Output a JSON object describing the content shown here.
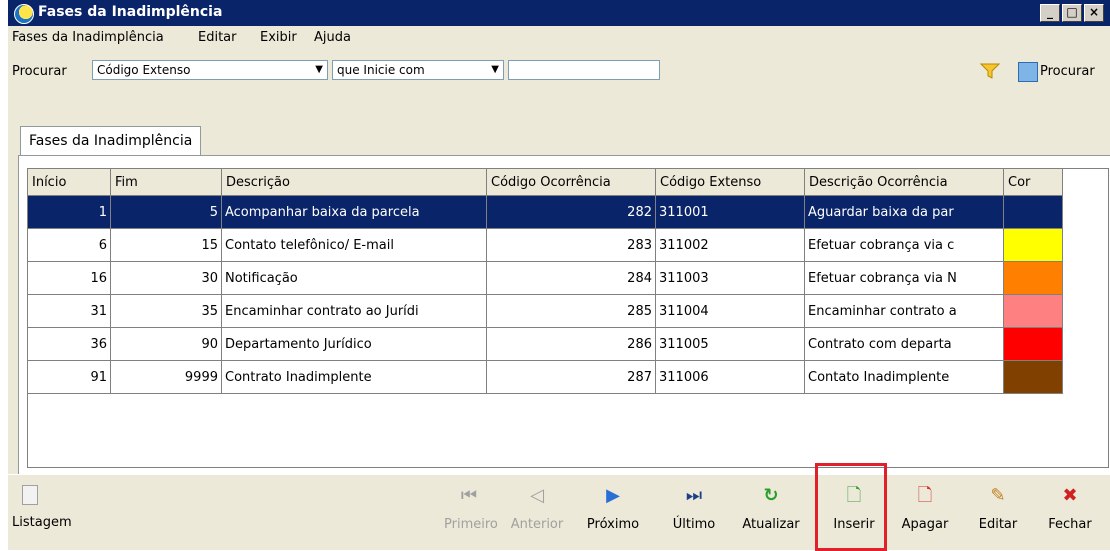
{
  "window": {
    "title": "Fases da Inadimplência"
  },
  "menu": [
    {
      "label": "Fases da Inadimplência"
    },
    {
      "label": "Editar"
    },
    {
      "label": "Exibir"
    },
    {
      "label": "Ajuda"
    }
  ],
  "search": {
    "label": "Procurar",
    "field": "Código Extenso",
    "mode": "que Inicie com",
    "value": "",
    "button_label": "Procurar"
  },
  "tab": {
    "label": "Fases da Inadimplência"
  },
  "grid": {
    "columns": [
      "Início",
      "Fim",
      "Descrição",
      "Código Ocorrência",
      "Código Extenso",
      "Descrição Ocorrência",
      "Cor"
    ],
    "rows": [
      {
        "inicio": "1",
        "fim": "5",
        "descricao": "Acompanhar baixa da parcela",
        "cod_ocorrencia": "282",
        "cod_extenso": "311001",
        "desc_ocorrencia": "Aguardar baixa da par",
        "cor": "#0a246a",
        "selected": true
      },
      {
        "inicio": "6",
        "fim": "15",
        "descricao": "Contato telefônico/ E-mail",
        "cod_ocorrencia": "283",
        "cod_extenso": "311002",
        "desc_ocorrencia": "Efetuar cobrança via c",
        "cor": "#ffff00"
      },
      {
        "inicio": "16",
        "fim": "30",
        "descricao": "Notificação",
        "cod_ocorrencia": "284",
        "cod_extenso": "311003",
        "desc_ocorrencia": "Efetuar cobrança via N",
        "cor": "#ff8000"
      },
      {
        "inicio": "31",
        "fim": "35",
        "descricao": "Encaminhar contrato ao Jurídi",
        "cod_ocorrencia": "285",
        "cod_extenso": "311004",
        "desc_ocorrencia": "Encaminhar contrato a",
        "cor": "#ff8080"
      },
      {
        "inicio": "36",
        "fim": "90",
        "descricao": "Departamento Jurídico",
        "cod_ocorrencia": "286",
        "cod_extenso": "311005",
        "desc_ocorrencia": "Contrato com departa",
        "cor": "#ff0000"
      },
      {
        "inicio": "91",
        "fim": "9999",
        "descricao": "Contrato Inadimplente",
        "cod_ocorrencia": "287",
        "cod_extenso": "311006",
        "desc_ocorrencia": "Contato Inadimplente",
        "cor": "#804000"
      }
    ]
  },
  "toolbar": {
    "listagem": "Listagem",
    "primeiro": "Primeiro",
    "anterior": "Anterior",
    "proximo": "Próximo",
    "ultimo": "Último",
    "atualizar": "Atualizar",
    "inserir": "Inserir",
    "apagar": "Apagar",
    "editar": "Editar",
    "fechar": "Fechar"
  }
}
